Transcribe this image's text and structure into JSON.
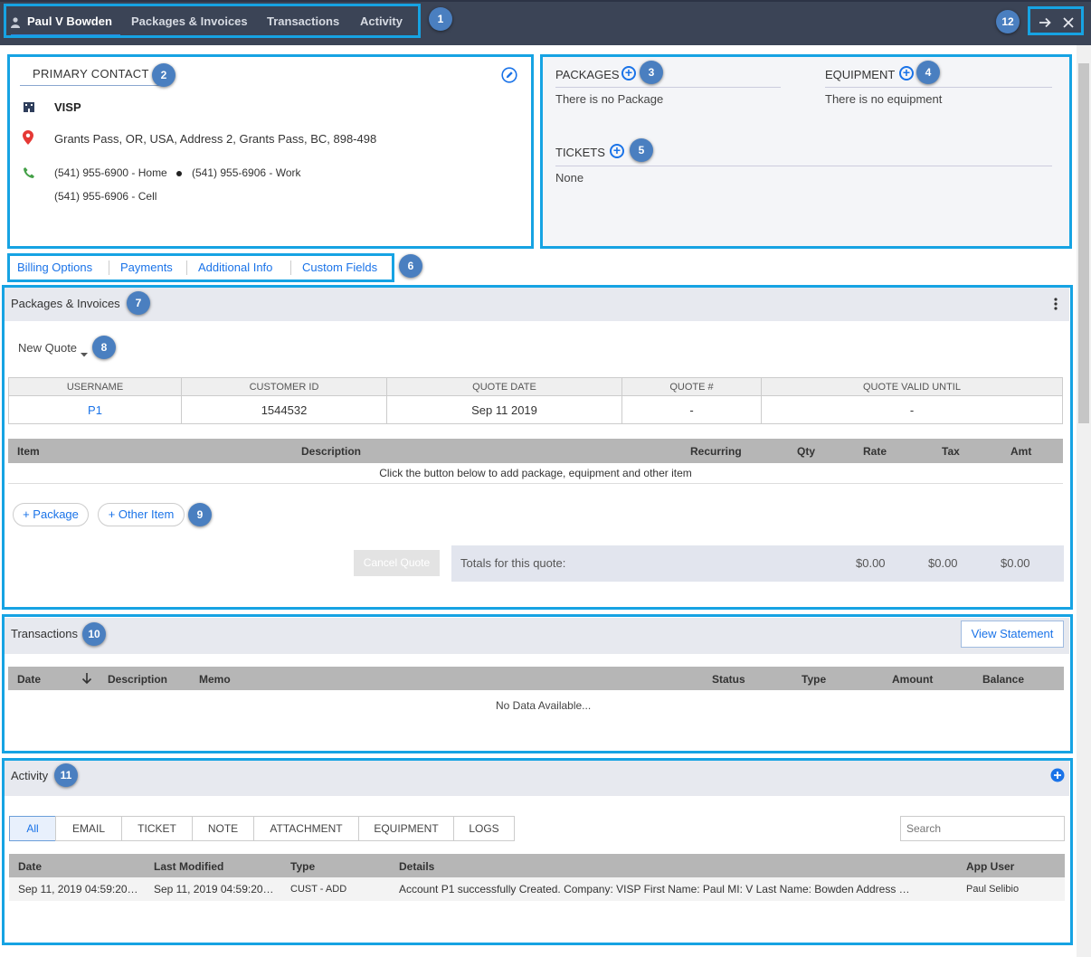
{
  "topbar": {
    "user_name": "Paul V Bowden",
    "tabs": [
      "Packages & Invoices",
      "Transactions",
      "Activity"
    ]
  },
  "badges": [
    "1",
    "2",
    "3",
    "4",
    "5",
    "6",
    "7",
    "8",
    "9",
    "10",
    "11",
    "12"
  ],
  "contact": {
    "heading": "PRIMARY CONTACT",
    "company": "VISP",
    "address": "Grants Pass, OR, USA, Address 2, Grants Pass, BC, 898-498",
    "phone_home": "(541) 955-6900 - Home",
    "phone_work": "(541) 955-6906 - Work",
    "phone_cell": "(541) 955-6906 - Cell"
  },
  "packages": {
    "heading": "PACKAGES",
    "empty": "There is no Package"
  },
  "equipment": {
    "heading": "EQUIPMENT",
    "empty": "There is no equipment"
  },
  "tickets": {
    "heading": "TICKETS",
    "empty": "None"
  },
  "sublinks": [
    "Billing Options",
    "Payments",
    "Additional Info",
    "Custom Fields"
  ],
  "pkg_invoices": {
    "title": "Packages & Invoices",
    "new_quote": "New Quote",
    "quote_cols": [
      "USERNAME",
      "CUSTOMER ID",
      "QUOTE DATE",
      "QUOTE #",
      "QUOTE VALID UNTIL"
    ],
    "quote_row": [
      "P1",
      "1544532",
      "Sep 11 2019",
      "-",
      "-"
    ],
    "item_cols": [
      "Item",
      "Description",
      "Recurring",
      "Qty",
      "Rate",
      "Tax",
      "Amt"
    ],
    "empty_msg": "Click the button below to add package, equipment and other item",
    "add_package": "+ Package",
    "add_other": "+ Other Item",
    "cancel_quote": "Cancel Quote",
    "totals_label": "Totals for this quote:",
    "totals": [
      "$0.00",
      "$0.00",
      "$0.00"
    ]
  },
  "transactions": {
    "title": "Transactions",
    "view_statement": "View Statement",
    "cols": [
      "Date",
      "Description",
      "Memo",
      "Status",
      "Type",
      "Amount",
      "Balance"
    ],
    "empty": "No Data Available..."
  },
  "activity": {
    "title": "Activity",
    "tabs": [
      "All",
      "EMAIL",
      "TICKET",
      "NOTE",
      "ATTACHMENT",
      "EQUIPMENT",
      "LOGS"
    ],
    "search_placeholder": "Search",
    "cols": [
      "Date",
      "Last Modified",
      "Type",
      "Details",
      "App User"
    ],
    "row": {
      "date": "Sep 11, 2019 04:59:20…",
      "modified": "Sep 11, 2019 04:59:20…",
      "type": "CUST - ADD",
      "details": "Account P1 successfully Created. Company: VISP First Name: Paul MI: V Last Name: Bowden Address …",
      "user": "Paul Selibio"
    }
  },
  "colors": {
    "topbar": "#3b4456",
    "accent": "#1a73e8",
    "callout": "#16a3e3",
    "badge": "#4a7fc0"
  }
}
